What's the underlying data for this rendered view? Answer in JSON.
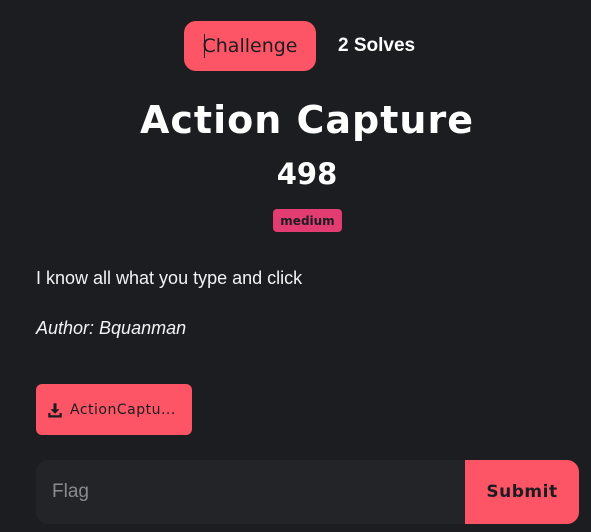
{
  "tabs": {
    "challenge_label": "Challenge",
    "solves_label": "2 Solves"
  },
  "challenge": {
    "title": "Action Capture",
    "points": "498",
    "difficulty": "medium",
    "description": "I know all what you type and click",
    "author": "Author: Bquanman",
    "file_label": "ActionCaptu..."
  },
  "flag_form": {
    "placeholder": "Flag",
    "value": "",
    "submit_label": "Submit"
  },
  "icons": {
    "file_button_icon": "download-icon"
  },
  "colors": {
    "background": "#1c1d21",
    "accent": "#fd5566",
    "badge": "#e23c72",
    "input_background": "#232427"
  }
}
